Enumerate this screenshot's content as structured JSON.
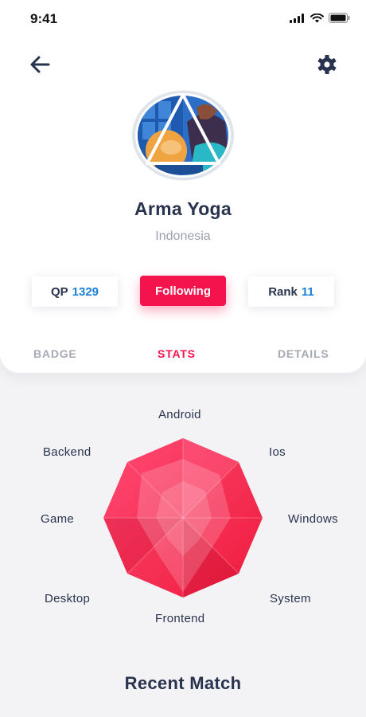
{
  "status_bar": {
    "time": "9:41"
  },
  "header": {
    "back_icon": "arrow-left-icon",
    "settings_icon": "gear-icon"
  },
  "profile": {
    "name": "Arma Yoga",
    "country": "Indonesia"
  },
  "stats": {
    "qp_label": "QP",
    "qp_value": "1329",
    "follow_label": "Following",
    "rank_label": "Rank",
    "rank_value": "11"
  },
  "tabs": [
    {
      "label": "BADGE",
      "active": false
    },
    {
      "label": "STATS",
      "active": true
    },
    {
      "label": "DETAILS",
      "active": false
    }
  ],
  "skills": {
    "android": "Android",
    "ios": "Ios",
    "windows": "Windows",
    "system": "System",
    "frontend": "Frontend",
    "desktop": "Desktop",
    "game": "Game",
    "backend": "Backend"
  },
  "colors": {
    "accent": "#f5134e",
    "number": "#1c7fd6",
    "text": "#28334d"
  },
  "section": {
    "recent_match": "Recent Match"
  }
}
